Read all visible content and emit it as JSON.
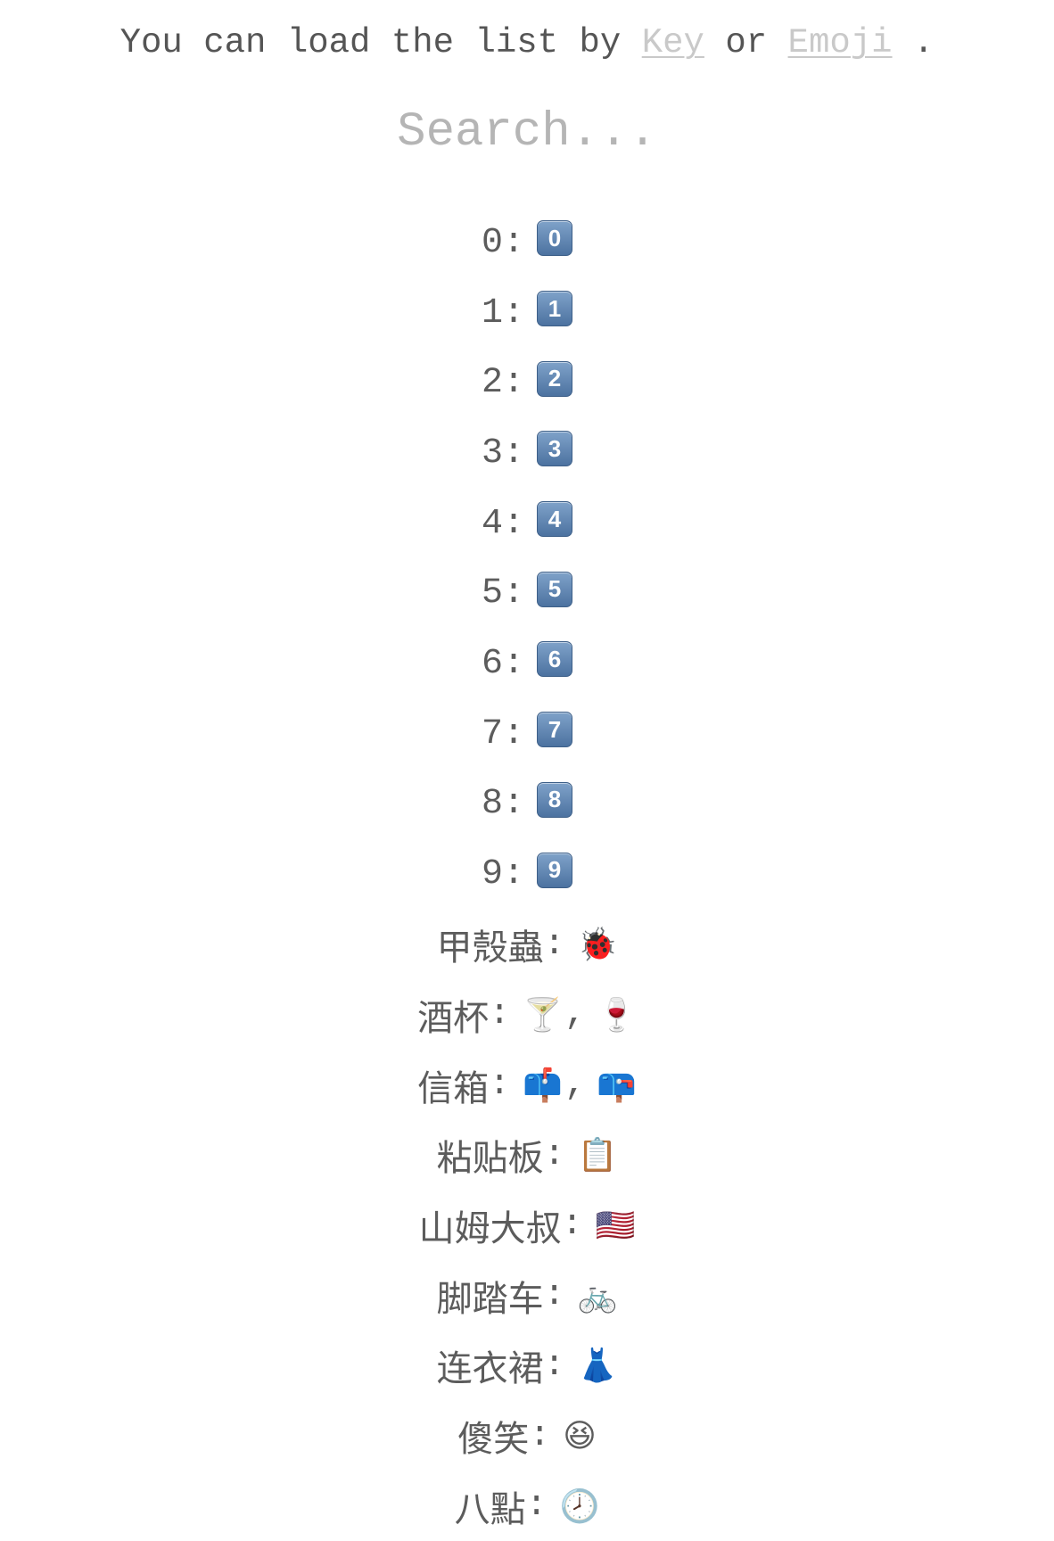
{
  "intro": {
    "prefix": "You can load the list by ",
    "link_key": "Key",
    "middle": " or ",
    "link_emoji": "Emoji",
    "suffix": " ."
  },
  "search": {
    "placeholder": "Search..."
  },
  "digits": [
    {
      "key": "0",
      "cap": "0"
    },
    {
      "key": "1",
      "cap": "1"
    },
    {
      "key": "2",
      "cap": "2"
    },
    {
      "key": "3",
      "cap": "3"
    },
    {
      "key": "4",
      "cap": "4"
    },
    {
      "key": "5",
      "cap": "5"
    },
    {
      "key": "6",
      "cap": "6"
    },
    {
      "key": "7",
      "cap": "7"
    },
    {
      "key": "8",
      "cap": "8"
    },
    {
      "key": "9",
      "cap": "9"
    }
  ],
  "separator": ":",
  "words": [
    {
      "key": "甲殼蟲",
      "emojis": [
        "🐞"
      ]
    },
    {
      "key": "酒杯",
      "emojis": [
        "🍸",
        "🍷"
      ]
    },
    {
      "key": "信箱",
      "emojis": [
        "📫",
        "📪"
      ]
    },
    {
      "key": "粘贴板",
      "emojis": [
        "📋"
      ]
    },
    {
      "key": "山姆大叔",
      "emojis": [
        "🇺🇸"
      ]
    },
    {
      "key": "脚踏车",
      "emojis": [
        "🚲"
      ]
    },
    {
      "key": "连衣裙",
      "emojis": [
        "👗"
      ]
    },
    {
      "key": "傻笑",
      "emojis": [
        "😆"
      ]
    },
    {
      "key": "八點",
      "emojis": [
        "🕗"
      ]
    }
  ],
  "icons": {
    "keycap": "keycap-digit-icon"
  },
  "colors": {
    "text": "#555555",
    "link": "#c9c9c9",
    "placeholder": "#b5b5b5",
    "keycap_top": "#7fa2c9",
    "keycap_bottom": "#4c72a0"
  }
}
